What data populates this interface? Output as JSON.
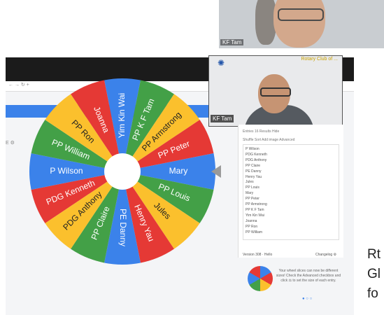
{
  "top_video": {
    "name_tag": "KF Tam"
  },
  "browser": {
    "url": "← → ↻ +",
    "settings_mark": "E ⚙"
  },
  "mid_video": {
    "name_tag": "KF Tam",
    "club": "Rotary Club of ...",
    "logo_icon": "rotary-logo-icon"
  },
  "wheel": {
    "entries": [
      "Yim Kin Wai",
      "PP K F Tam",
      "PP Armstrong",
      "PP Peter",
      "Mary",
      "PP Louis",
      "Jules",
      "Henry Yau",
      "PE Danny",
      "PP Claire",
      "PDG Anthony",
      "PDG Kenneth",
      "P Wilson",
      "PP William",
      "PP Ron",
      "Joanna"
    ],
    "colors": [
      "#3b82ea",
      "#43a047",
      "#fbc02d",
      "#e53935"
    ]
  },
  "panel": {
    "tabs": "Entries 16   Results   Hide",
    "toolbar": "Shuffle   Sort   Add image   Advanced",
    "names": [
      "P Wilson",
      "PDG Kenneth",
      "PDG Anthony",
      "PP Claire",
      "PE Danny",
      "Henry Yau",
      "Jules",
      "PP Louis",
      "Mary",
      "PP Peter",
      "PP Armstrong",
      "PP K F Tam",
      "Yim Kin Wai",
      "Joanna",
      "PP Ron",
      "PP William"
    ],
    "version": "Version 308 · Hello",
    "changelog": "Changelog ⚙",
    "promo": "Your wheel slices can now be different sizes! Check the Advanced checkbox and click ⚖ to set the size of each entry.",
    "dots": "● ○ ○"
  },
  "caption": [
    "Rt",
    "Gl",
    "fo"
  ]
}
